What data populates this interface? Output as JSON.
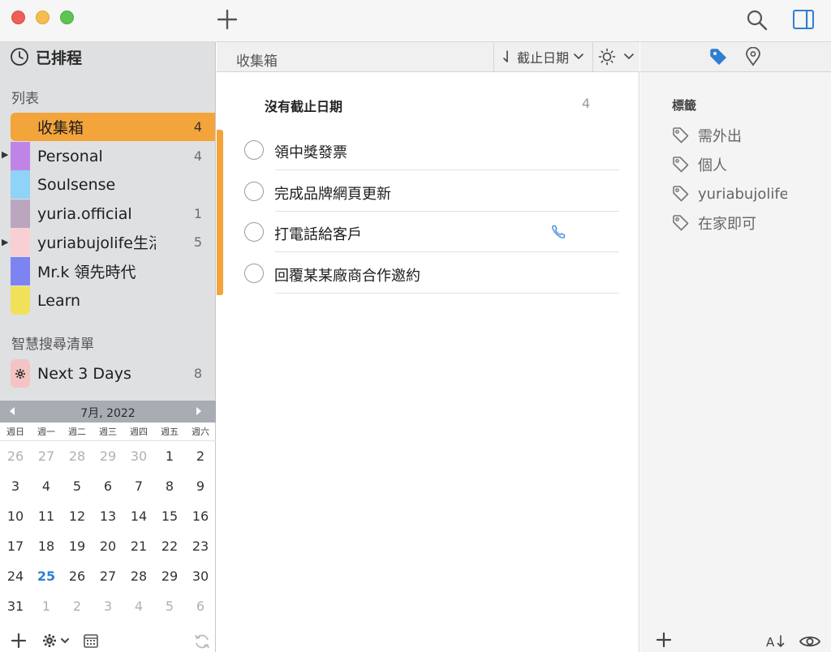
{
  "sidebar": {
    "scheduled_label": "已排程",
    "lists_header": "列表",
    "lists": [
      {
        "name": "收集箱",
        "count": "4",
        "color": "#f3a43b"
      },
      {
        "name": "Personal",
        "count": "4",
        "color": "#c084e6"
      },
      {
        "name": "Soulsense",
        "count": "",
        "color": "#8fd3f7"
      },
      {
        "name": "yuria.official",
        "count": "1",
        "color": "#bba6bf"
      },
      {
        "name": "yuriabujolife生活",
        "count": "5",
        "color": "#f8cfd2"
      },
      {
        "name": "Mr.k 領先時代",
        "count": "",
        "color": "#7d84f2"
      },
      {
        "name": "Learn",
        "count": "",
        "color": "#f1e15a"
      }
    ],
    "smart_header": "智慧搜尋清單",
    "smart_lists": [
      {
        "name": "Next 3 Days",
        "count": "8",
        "color": "#f4c4c4"
      }
    ]
  },
  "calendar": {
    "month_label": "7月, 2022",
    "weekdays": [
      "週日",
      "週一",
      "週二",
      "週三",
      "週四",
      "週五",
      "週六"
    ],
    "weeks": [
      [
        "26",
        "27",
        "28",
        "29",
        "30",
        "1",
        "2"
      ],
      [
        "3",
        "4",
        "5",
        "6",
        "7",
        "8",
        "9"
      ],
      [
        "10",
        "11",
        "12",
        "13",
        "14",
        "15",
        "16"
      ],
      [
        "17",
        "18",
        "19",
        "20",
        "21",
        "22",
        "23"
      ],
      [
        "24",
        "25",
        "26",
        "27",
        "28",
        "29",
        "30"
      ],
      [
        "31",
        "1",
        "2",
        "3",
        "4",
        "5",
        "6"
      ]
    ],
    "today": "25"
  },
  "main": {
    "title": "收集箱",
    "sort_label": "截止日期",
    "group_header": "沒有截止日期",
    "group_count": "4",
    "tasks": [
      {
        "text": "領中獎發票"
      },
      {
        "text": "完成品牌網頁更新"
      },
      {
        "text": "打電話給客戶"
      },
      {
        "text": "回覆某某廠商合作邀約"
      }
    ]
  },
  "inspector": {
    "tags_header": "標籤",
    "tags": [
      "需外出",
      "個人",
      "yuriabujolife",
      "在家即可"
    ]
  },
  "colors": {
    "accent": "#f3a43b",
    "today": "#2f7fd1",
    "link_icon": "#4a8fd9"
  }
}
